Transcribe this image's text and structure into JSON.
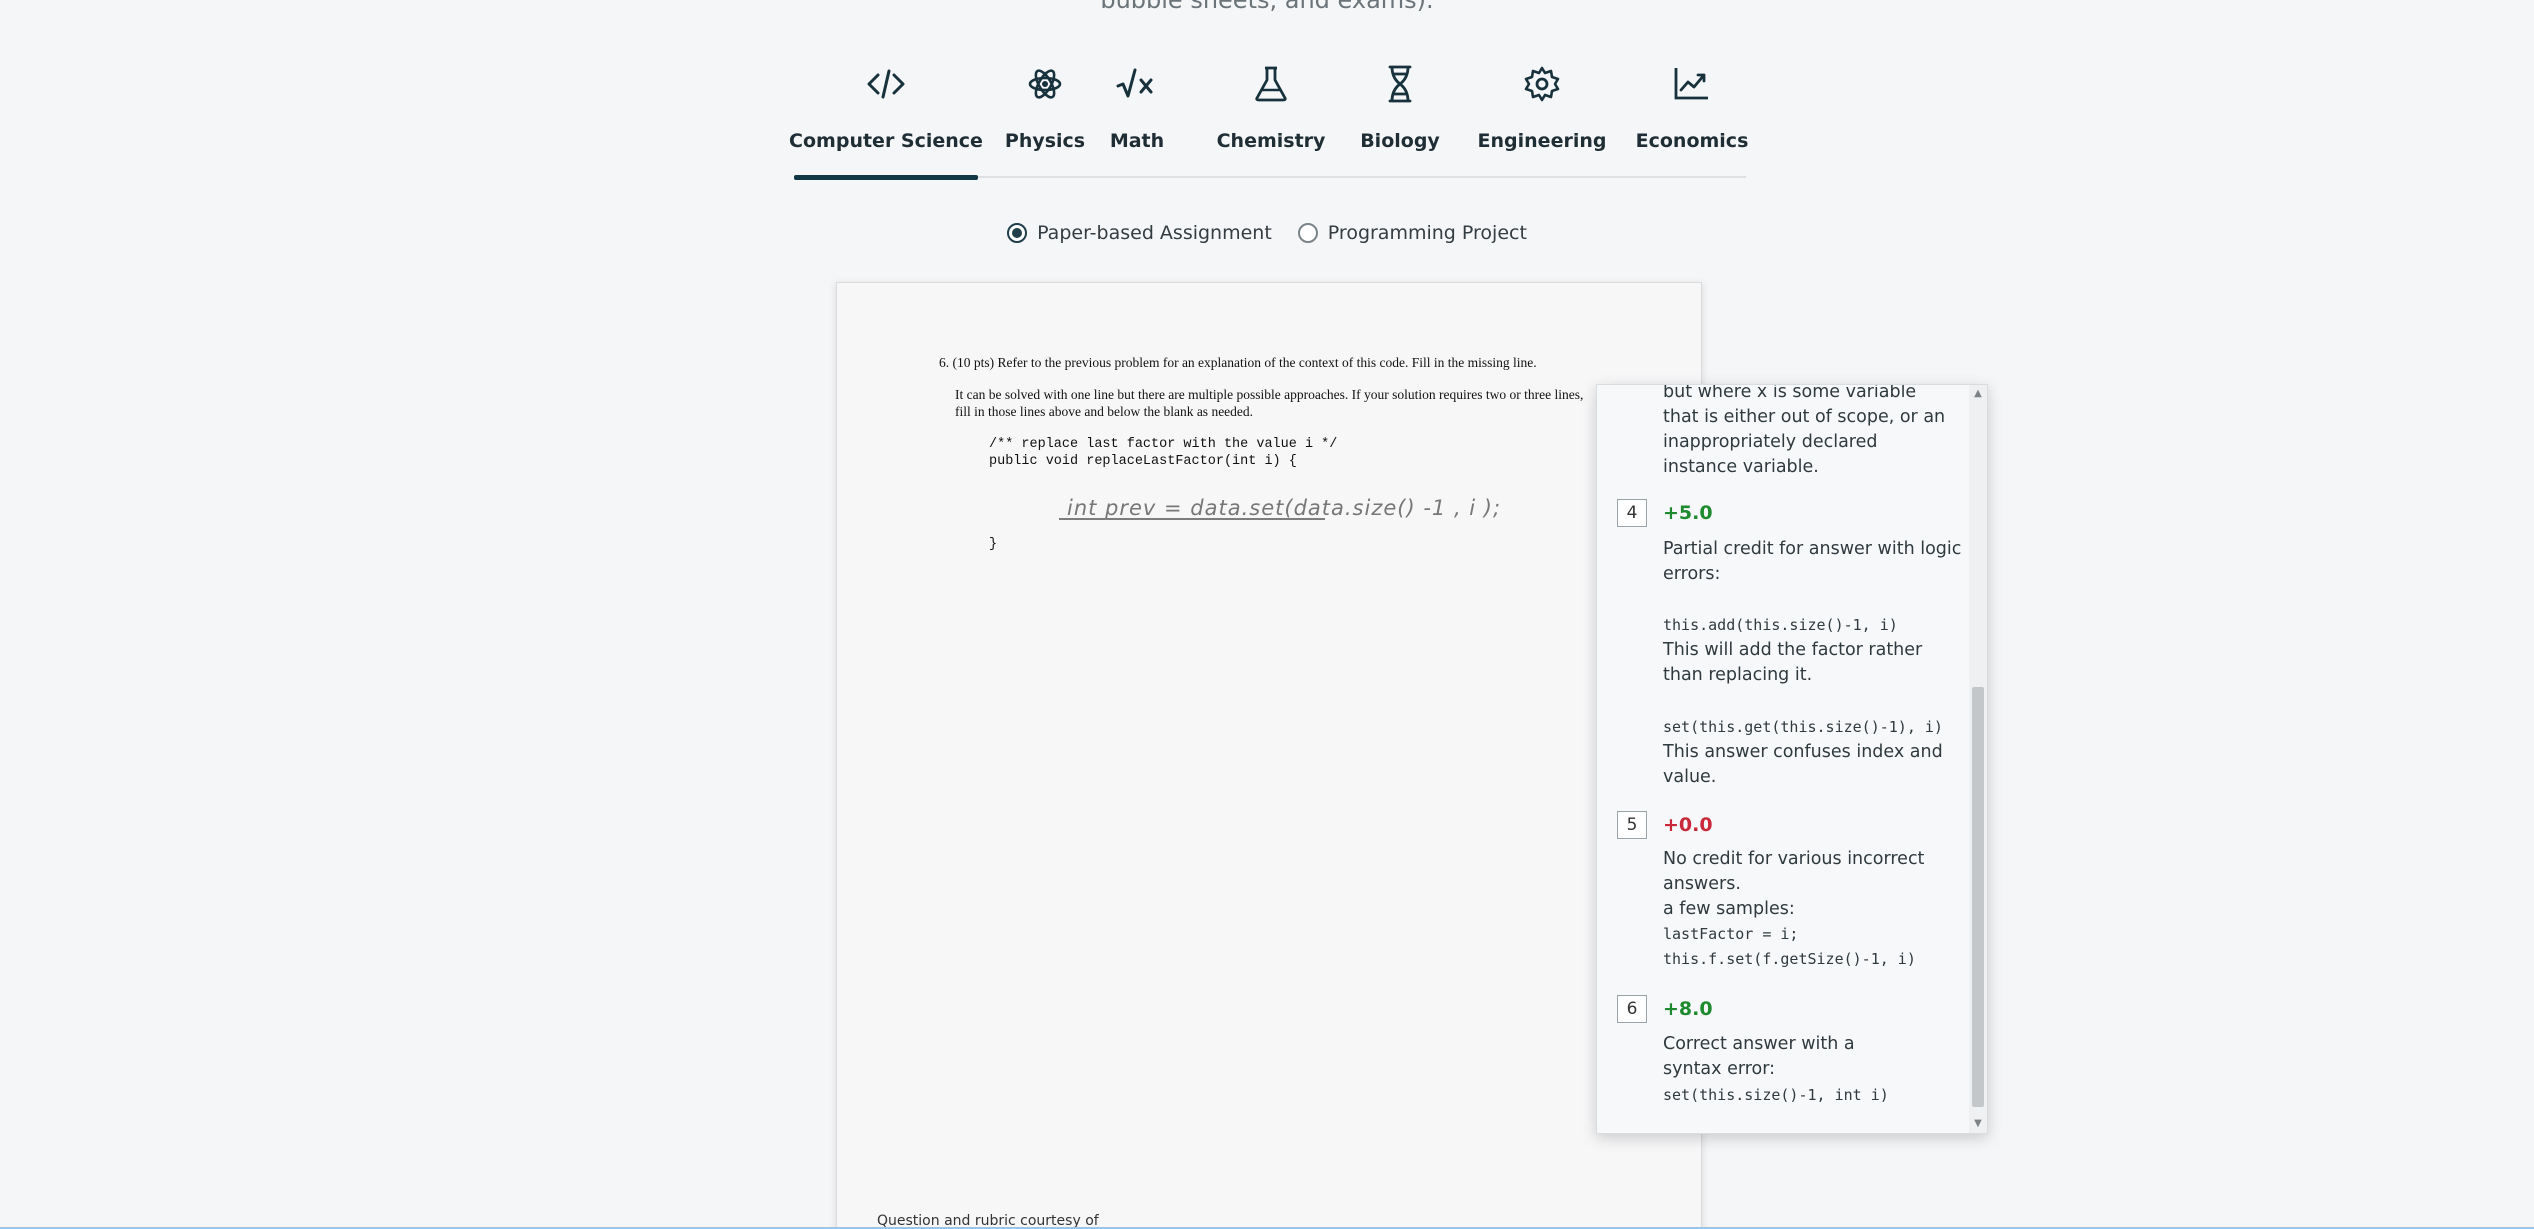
{
  "intro": "bubble sheets, and exams).",
  "tabs": [
    {
      "label": "Computer Science",
      "icon": "code-icon"
    },
    {
      "label": "Physics",
      "icon": "atom-icon"
    },
    {
      "label": "Math",
      "icon": "sqrt-icon"
    },
    {
      "label": "Chemistry",
      "icon": "flask-icon"
    },
    {
      "label": "Biology",
      "icon": "dna-icon"
    },
    {
      "label": "Engineering",
      "icon": "gear-icon"
    },
    {
      "label": "Economics",
      "icon": "chart-icon"
    }
  ],
  "active_tab": "Computer Science",
  "assignment_type": {
    "options": [
      "Paper-based Assignment",
      "Programming Project"
    ],
    "selected": "Paper-based Assignment"
  },
  "paper": {
    "question_title": "6. (10 pts) Refer to the previous problem for an explanation of the context of this code. Fill in the missing line.",
    "question_body": "It can be solved with one line but there are multiple possible approaches. If your solution requires two or three lines, fill in those lines above and below the blank as needed.",
    "code_line1": "/** replace last factor with the value i */",
    "code_line2": "public void replaceLastFactor(int i) {",
    "code_close": "}",
    "handwritten_answer": "int prev = data.set(data.size() -1 , i );",
    "courtesy": "Question and rubric courtesy of"
  },
  "rubric": {
    "top_text": "but where x is some variable that is either out of scope, or an inappropriately declared instance variable.",
    "items": [
      {
        "number": "4",
        "points": "+5.0",
        "desc": "Partial credit for answer with logic errors:",
        "code1": "this.add(this.size()-1, i)",
        "note1": "This will add the factor rather than replacing it.",
        "code2": "set(this.get(this.size()-1), i)",
        "note2": "This answer confuses index and value."
      },
      {
        "number": "5",
        "points": "+0.0",
        "desc": "No credit for various incorrect answers.",
        "note1": "a few samples:",
        "code1": "lastFactor = i;",
        "code2": "this.f.set(f.getSize()-1, i)"
      },
      {
        "number": "6",
        "points": "+8.0",
        "desc": "Correct answer with a syntax error:",
        "code1": "set(this.size()-1, int i)"
      }
    ]
  },
  "colors": {
    "positive": "#1e8a2e",
    "negative": "#c8283a",
    "tab_active": "#113845"
  }
}
